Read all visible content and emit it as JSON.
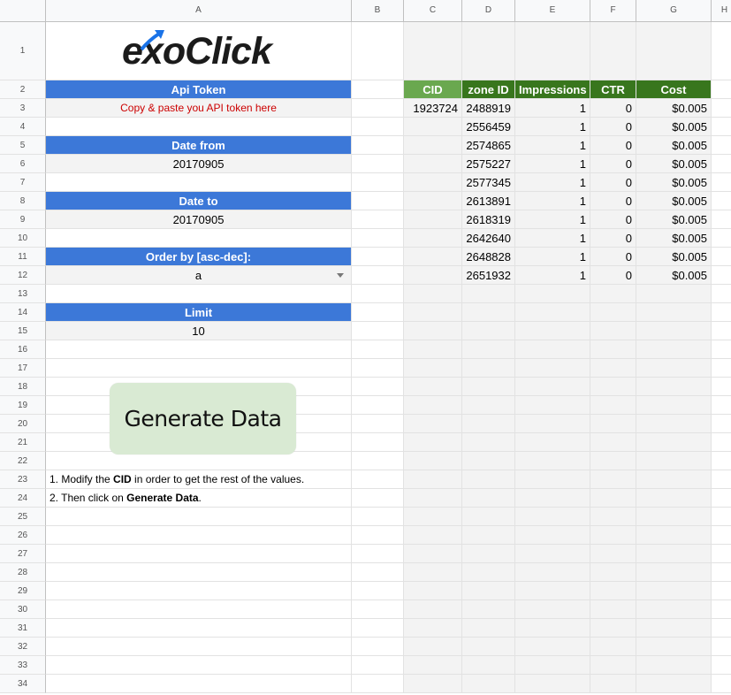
{
  "columns": [
    "A",
    "B",
    "C",
    "D",
    "E",
    "F",
    "G",
    "H"
  ],
  "rows": [
    "1",
    "2",
    "3",
    "4",
    "5",
    "6",
    "7",
    "8",
    "9",
    "10",
    "11",
    "12",
    "13",
    "14",
    "15",
    "16",
    "17",
    "18",
    "19",
    "20",
    "21",
    "22",
    "23",
    "24",
    "25",
    "26",
    "27",
    "28",
    "29",
    "30",
    "31",
    "32",
    "33",
    "34"
  ],
  "logo": {
    "prefix": "e",
    "suffix": "oClick",
    "letter_x": "x",
    "icon": "upward-arrow-icon",
    "arrow_color": "#1a73e8"
  },
  "form": {
    "api_token_label": "Api Token",
    "api_token_value": "Copy & paste you API token here",
    "date_from_label": "Date from",
    "date_from_value": "20170905",
    "date_to_label": "Date to",
    "date_to_value": "20170905",
    "order_label": "Order by [asc-dec]:",
    "order_value": "a",
    "limit_label": "Limit",
    "limit_value": "10"
  },
  "button": {
    "label": "Generate Data"
  },
  "notes": {
    "line1_pre": "1. Modify the ",
    "line1_bold": "CID",
    "line1_post": " in order to get the rest of the values.",
    "line2_pre": "2. Then click on ",
    "line2_bold": "Generate Data",
    "line2_post": "."
  },
  "table": {
    "headers": [
      "CID",
      "zone ID",
      "Impressions",
      "CTR",
      "Cost"
    ],
    "cid": "1923724",
    "rows": [
      {
        "zone": "2488919",
        "impressions": "1",
        "ctr": "0",
        "cost": "$0.005"
      },
      {
        "zone": "2556459",
        "impressions": "1",
        "ctr": "0",
        "cost": "$0.005"
      },
      {
        "zone": "2574865",
        "impressions": "1",
        "ctr": "0",
        "cost": "$0.005"
      },
      {
        "zone": "2575227",
        "impressions": "1",
        "ctr": "0",
        "cost": "$0.005"
      },
      {
        "zone": "2577345",
        "impressions": "1",
        "ctr": "0",
        "cost": "$0.005"
      },
      {
        "zone": "2613891",
        "impressions": "1",
        "ctr": "0",
        "cost": "$0.005"
      },
      {
        "zone": "2618319",
        "impressions": "1",
        "ctr": "0",
        "cost": "$0.005"
      },
      {
        "zone": "2642640",
        "impressions": "1",
        "ctr": "0",
        "cost": "$0.005"
      },
      {
        "zone": "2648828",
        "impressions": "1",
        "ctr": "0",
        "cost": "$0.005"
      },
      {
        "zone": "2651932",
        "impressions": "1",
        "ctr": "0",
        "cost": "$0.005"
      }
    ]
  },
  "colors": {
    "blue_header": "#3c78d8",
    "green_header": "#6aa84f",
    "dark_green_header": "#38761d",
    "button_bg": "#d9ead3",
    "input_bg": "#f3f3f3"
  }
}
